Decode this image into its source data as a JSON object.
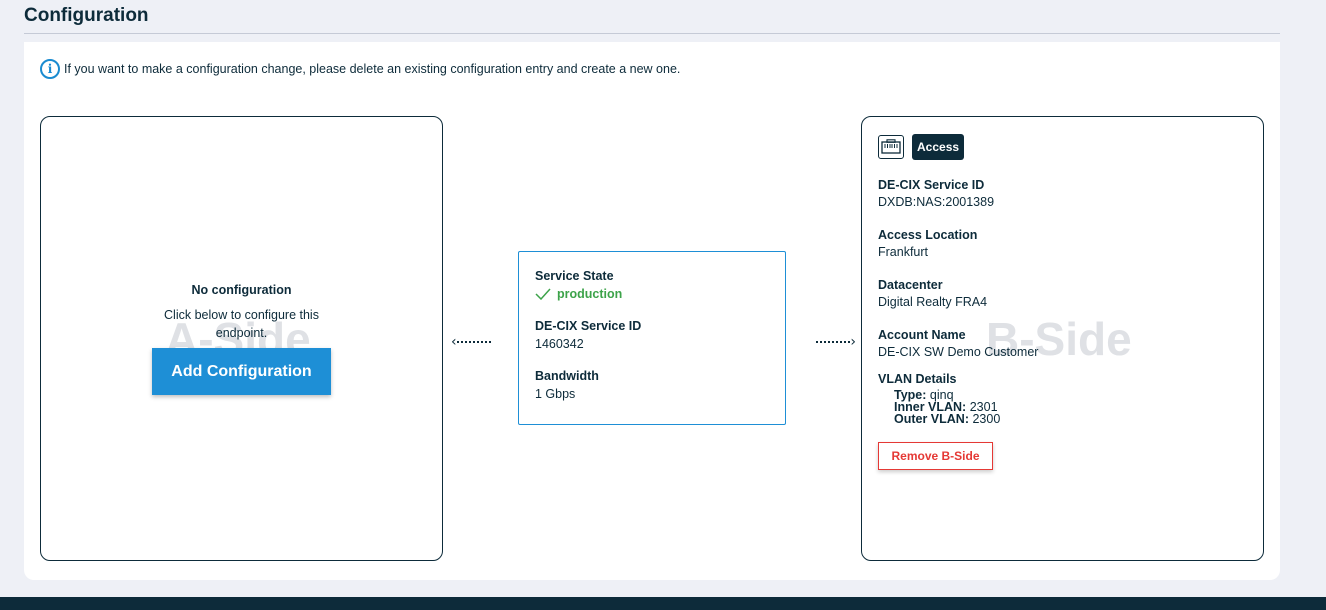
{
  "page": {
    "title": "Configuration"
  },
  "info": {
    "text": "If you want to make a configuration change, please delete an existing configuration entry and create a new one."
  },
  "a_side": {
    "watermark": "A-Side",
    "title": "No configuration",
    "description": "Click below to configure this endpoint.",
    "button_label": "Add Configuration"
  },
  "service": {
    "state_label": "Service State",
    "state_value": "production",
    "id_label": "DE-CIX Service ID",
    "id_value": "1460342",
    "bandwidth_label": "Bandwidth",
    "bandwidth_value": "1 Gbps"
  },
  "b_side": {
    "watermark": "B-Side",
    "badge": "Access",
    "service_id_label": "DE-CIX Service ID",
    "service_id_value": "DXDB:NAS:2001389",
    "location_label": "Access Location",
    "location_value": "Frankfurt",
    "datacenter_label": "Datacenter",
    "datacenter_value": "Digital Realty FRA4",
    "account_label": "Account Name",
    "account_value": "DE-CIX SW Demo Customer",
    "vlan_label": "VLAN Details",
    "vlan_type_label": "Type:",
    "vlan_type_value": "qinq",
    "vlan_inner_label": "Inner VLAN:",
    "vlan_inner_value": "2301",
    "vlan_outer_label": "Outer VLAN:",
    "vlan_outer_value": "2300",
    "remove_label": "Remove B-Side"
  },
  "colors": {
    "primary": "#1e8fd6",
    "dark": "#0d2b3a",
    "success": "#3da34a",
    "danger": "#e53935"
  }
}
